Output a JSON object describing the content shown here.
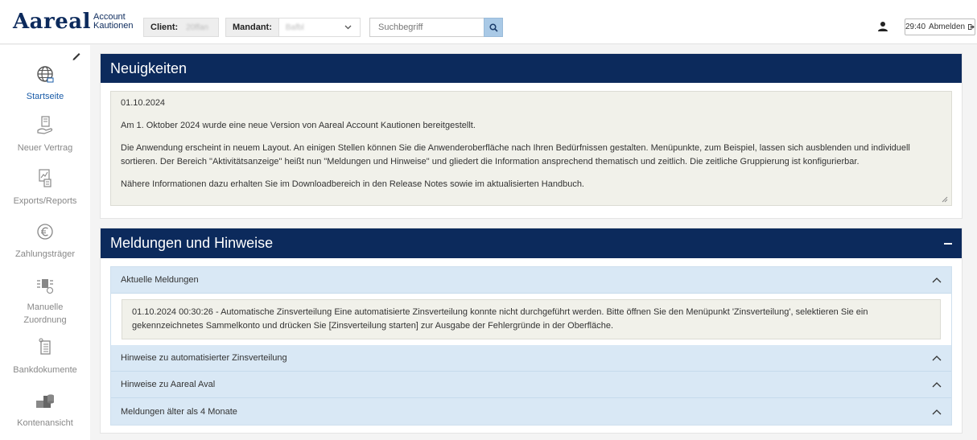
{
  "header": {
    "logo_main": "Aareal",
    "logo_sub_1": "Account",
    "logo_sub_2": "Kautionen",
    "client_label": "Client:",
    "client_value": "20ffan",
    "mandant_label": "Mandant:",
    "mandant_value": "Bafbl",
    "search_placeholder": "Suchbegriff",
    "session_timer": "29:40",
    "logout_label": "Abmelden"
  },
  "sidebar": {
    "items": [
      {
        "label": "Startseite",
        "icon": "globe-icon",
        "active": true
      },
      {
        "label": "Neuer Vertrag",
        "icon": "contract-hand-icon",
        "active": false
      },
      {
        "label": "Exports/Reports",
        "icon": "export-report-icon",
        "active": false
      },
      {
        "label": "Zahlungsträger",
        "icon": "euro-icon",
        "active": false
      },
      {
        "label_line1": "Manuelle",
        "label_line2": "Zuordnung",
        "icon": "manual-assign-icon",
        "active": false
      },
      {
        "label": "Bankdokumente",
        "icon": "bank-document-icon",
        "active": false
      },
      {
        "label": "Kontenansicht",
        "icon": "accounts-view-icon",
        "active": false
      }
    ]
  },
  "news": {
    "title": "Neuigkeiten",
    "date": "01.10.2024",
    "para1": "Am 1. Oktober 2024 wurde eine neue Version von Aareal Account Kautionen bereitgestellt.",
    "para2": "Die Anwendung erscheint in neuem Layout. An einigen Stellen können Sie die Anwenderoberfläche nach Ihren Bedürfnissen gestalten. Menüpunkte, zum Beispiel, lassen sich ausblenden und individuell sortieren. Der Bereich \"Aktivitätsanzeige\" heißt nun \"Meldungen und Hinweise\" und gliedert die Information ansprechend thematisch und zeitlich. Die zeitliche Gruppierung ist konfigurierbar.",
    "para3": "Nähere Informationen dazu erhalten Sie im Downloadbereich in den Release Notes sowie im aktualisierten Handbuch."
  },
  "messages": {
    "title": "Meldungen und Hinweise",
    "sections": [
      {
        "label": "Aktuelle Meldungen",
        "expanded": true
      },
      {
        "label": "Hinweise zu automatisierter Zinsverteilung",
        "expanded": false
      },
      {
        "label": "Hinweise zu Aareal Aval",
        "expanded": false
      },
      {
        "label": "Meldungen älter als 4 Monate",
        "expanded": false
      }
    ],
    "current_message": "01.10.2024 00:30:26 - Automatische Zinsverteilung Eine automatisierte Zinsverteilung konnte nicht durchgeführt werden. Bitte öffnen Sie den Menüpunkt 'Zinsverteilung', selektieren Sie ein gekennzeichnetes Sammelkonto und drücken Sie [Zinsverteilung starten] zur Ausgabe der Fehlergründe in der Oberfläche."
  },
  "colors": {
    "brand_navy": "#0c2a5c",
    "accordion_header": "#d9e8f5",
    "search_button": "#a9c9e6",
    "active_nav": "#1a5ca8"
  }
}
